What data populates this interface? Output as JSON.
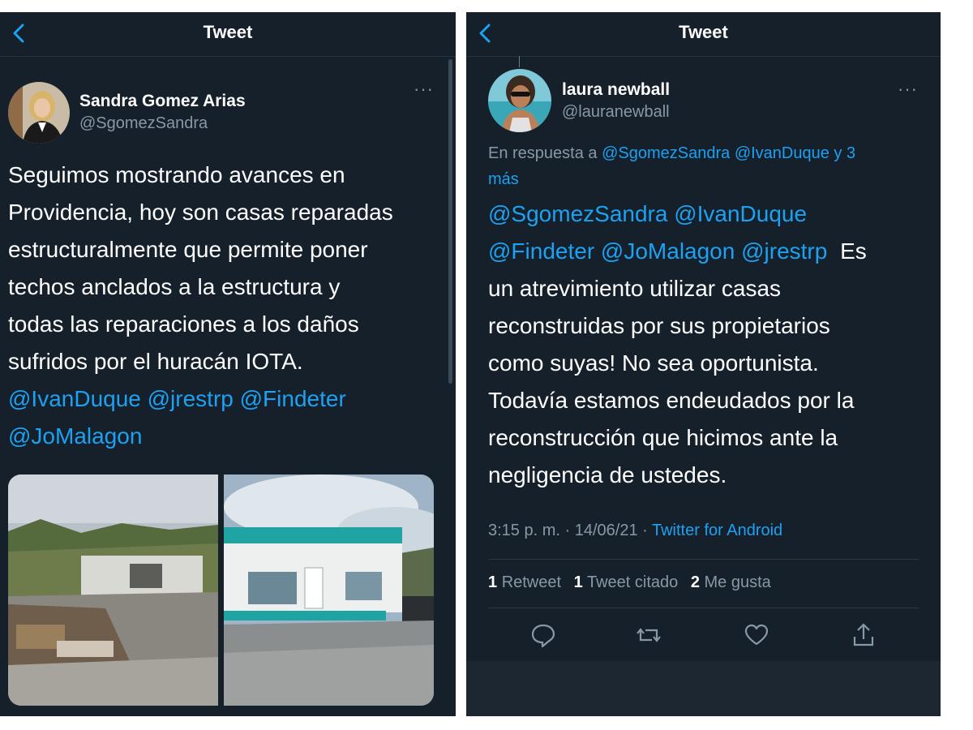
{
  "left": {
    "header_title": "Tweet",
    "author_name": "Sandra Gomez Arias",
    "author_handle": "@SgomezSandra",
    "text_lines": [
      "Seguimos mostrando avances en",
      "Providencia, hoy son casas reparadas",
      "estructuralmente que permite poner",
      "techos anclados a la estructura y",
      "todas las reparaciones a los daños",
      "sufridos por el huracán IOTA."
    ],
    "mentions_line1": "@IvanDuque @jrestrp @Findeter",
    "mentions_line2": "@JoMalagon"
  },
  "right": {
    "header_title": "Tweet",
    "author_name": "laura newball",
    "author_handle": "@lauranewball",
    "reply_prefix": "En respuesta a",
    "reply_mentions": "@SgomezSandra @IvanDuque y 3",
    "reply_mentions_2": "más",
    "mentions_line1": "@SgomezSandra @IvanDuque",
    "mentions_line2": "@Findeter @JoMalagon @jrestrp",
    "text_line2_tail": "Es",
    "text_lines": [
      "un atrevimiento utilizar casas",
      "reconstruidas por sus propietarios",
      "como suyas! No sea oportunista.",
      "Todavía estamos endeudados por la",
      "reconstrucción que hicimos ante la",
      "negligencia de ustedes."
    ],
    "timestamp": "3:15 p. m. · 14/06/21 ·",
    "source": "Twitter for Android",
    "retweets_count": "1",
    "retweets_label": "Retweet",
    "quotes_count": "1",
    "quotes_label": "Tweet citado",
    "likes_count": "2",
    "likes_label": "Me gusta"
  },
  "icons": [
    "back-arrow-icon",
    "more-icon",
    "reply-icon",
    "retweet-icon",
    "like-icon",
    "share-icon"
  ],
  "colors": {
    "background": "#15202b",
    "accent": "#1da1f2",
    "secondary_text": "#8899a6"
  }
}
